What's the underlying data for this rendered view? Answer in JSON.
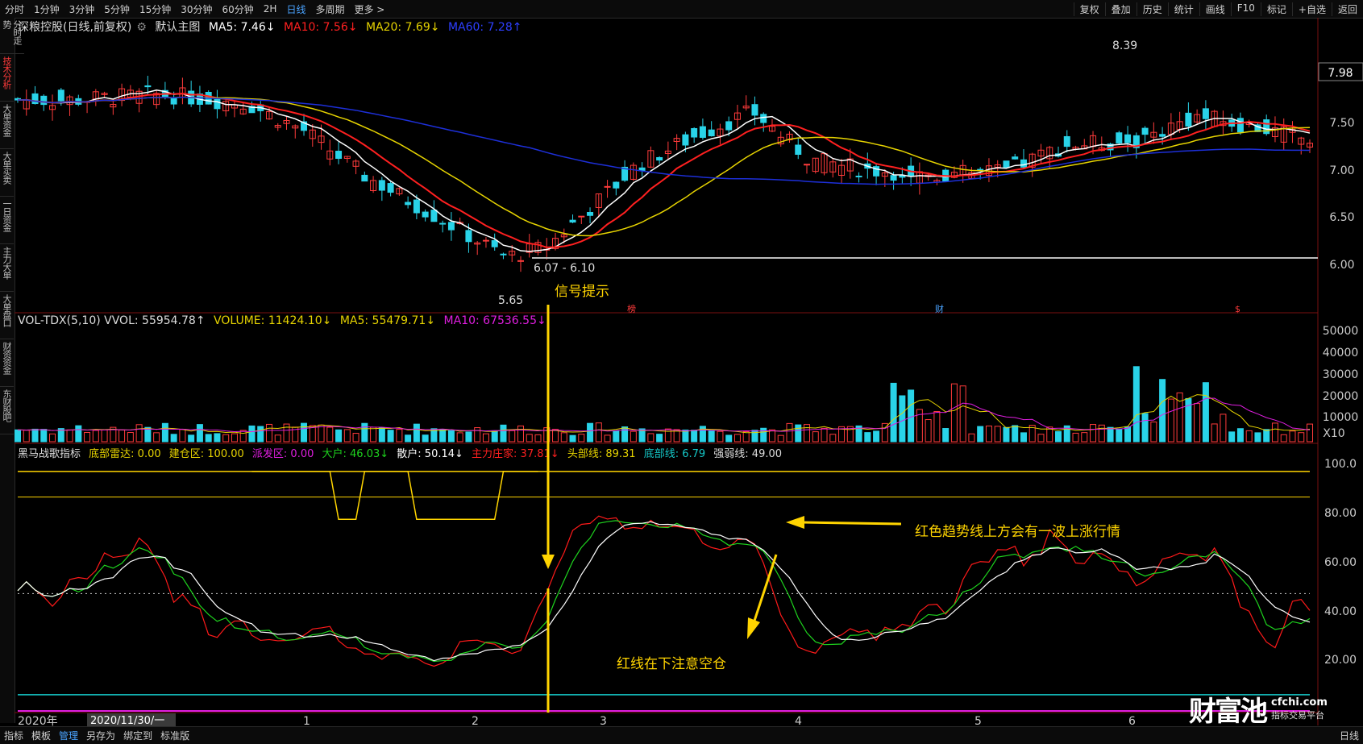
{
  "toolbar": {
    "left_vertical": "分时走势",
    "timeframes": [
      "分时",
      "1分钟",
      "3分钟",
      "5分钟",
      "15分钟",
      "30分钟",
      "60分钟",
      "2H",
      "日线",
      "多周期",
      "更多 >"
    ],
    "active_timeframe": "日线",
    "right_buttons": [
      "复权",
      "叠加",
      "历史",
      "统计",
      "画线",
      "F10",
      "标记",
      "+自选",
      "返回"
    ]
  },
  "left_tabs": [
    "技术分析",
    "大单资金",
    "大单买卖",
    "一日资金",
    "主力大单",
    "大单盘口",
    "财资资金",
    "东财股吧"
  ],
  "main_legend": {
    "stock": "深粮控股(日线,前复权)",
    "template": "默认主图",
    "ma5": "MA5: 7.46↓",
    "ma10": "MA10: 7.56↓",
    "ma20": "MA20: 7.69↓",
    "ma60": "MA60: 7.28↑"
  },
  "vol_legend": {
    "name": "VOL-TDX(5,10) VVOL: 55954.78↑",
    "volume": "VOLUME: 11424.10↓",
    "ma5": "MA5: 55479.71↓",
    "ma10": "MA10: 67536.55↓"
  },
  "ind_legend": {
    "name": "黑马战歌指标",
    "bottom_radar": "底部雷达: 0.00",
    "build": "建仓区: 100.00",
    "distribute": "派发区: 0.00",
    "big_holder": "大户: 46.03↓",
    "retail": "散户: 50.14↓",
    "main_force": "主力庄家: 37.81↓",
    "top_line": "头部线: 89.31",
    "bottom_line": "底部线: 6.79",
    "strength": "强弱线: 49.00"
  },
  "price_axis": [
    "7.50",
    "7.00",
    "6.50",
    "6.00"
  ],
  "price_current": "7.98",
  "vol_axis": [
    "50000",
    "40000",
    "30000",
    "20000",
    "10000",
    "X10"
  ],
  "ind_axis": [
    "100.0",
    "80.00",
    "60.00",
    "40.00",
    "20.00"
  ],
  "x_labels": [
    "2020年",
    "1",
    "2",
    "3",
    "4",
    "5",
    "6"
  ],
  "cursor_date": "2020/11/30/一",
  "annotations": {
    "high": "8.39",
    "low": "5.65",
    "range": "6.07 - 6.10",
    "signal": "信号提示",
    "trend_up": "红色趋势线上方会有一波上涨行情",
    "red_below": "红线在下注意空仓",
    "markers": [
      "榜",
      "财",
      "$"
    ]
  },
  "bottom_tabs": [
    "指标",
    "模板",
    "管理",
    "另存为",
    "绑定到",
    "标准版"
  ],
  "active_bottom_tab": "管理",
  "bottom_right": "日线",
  "watermark": {
    "brand": "财富池",
    "site": "cfchi.com",
    "slogan": "指标交易平台"
  },
  "colors": {
    "up": "#ff3b3b",
    "down": "#29d3e8",
    "ma5": "#ffffff",
    "ma10": "#ff2020",
    "ma20": "#e6d300",
    "ma60": "#1d2fd8",
    "yellow": "#ffd400",
    "cyan": "#15c9c9",
    "magenta": "#e01ee0",
    "green": "#1ed41e"
  },
  "chart_data": {
    "type": "candlestick",
    "title": "深粮控股(日线,前复权)",
    "ylim": [
      5.55,
      8.5
    ],
    "price_ticks": [
      6.0,
      6.5,
      7.0,
      7.5
    ],
    "high": 8.39,
    "low": 5.65,
    "hline": 6.07,
    "vol_ylim": [
      0,
      55000
    ],
    "ind_ylim": [
      0,
      105
    ],
    "ind_ticks": [
      20,
      40,
      60,
      80,
      100
    ],
    "volume_unit": "X10"
  }
}
